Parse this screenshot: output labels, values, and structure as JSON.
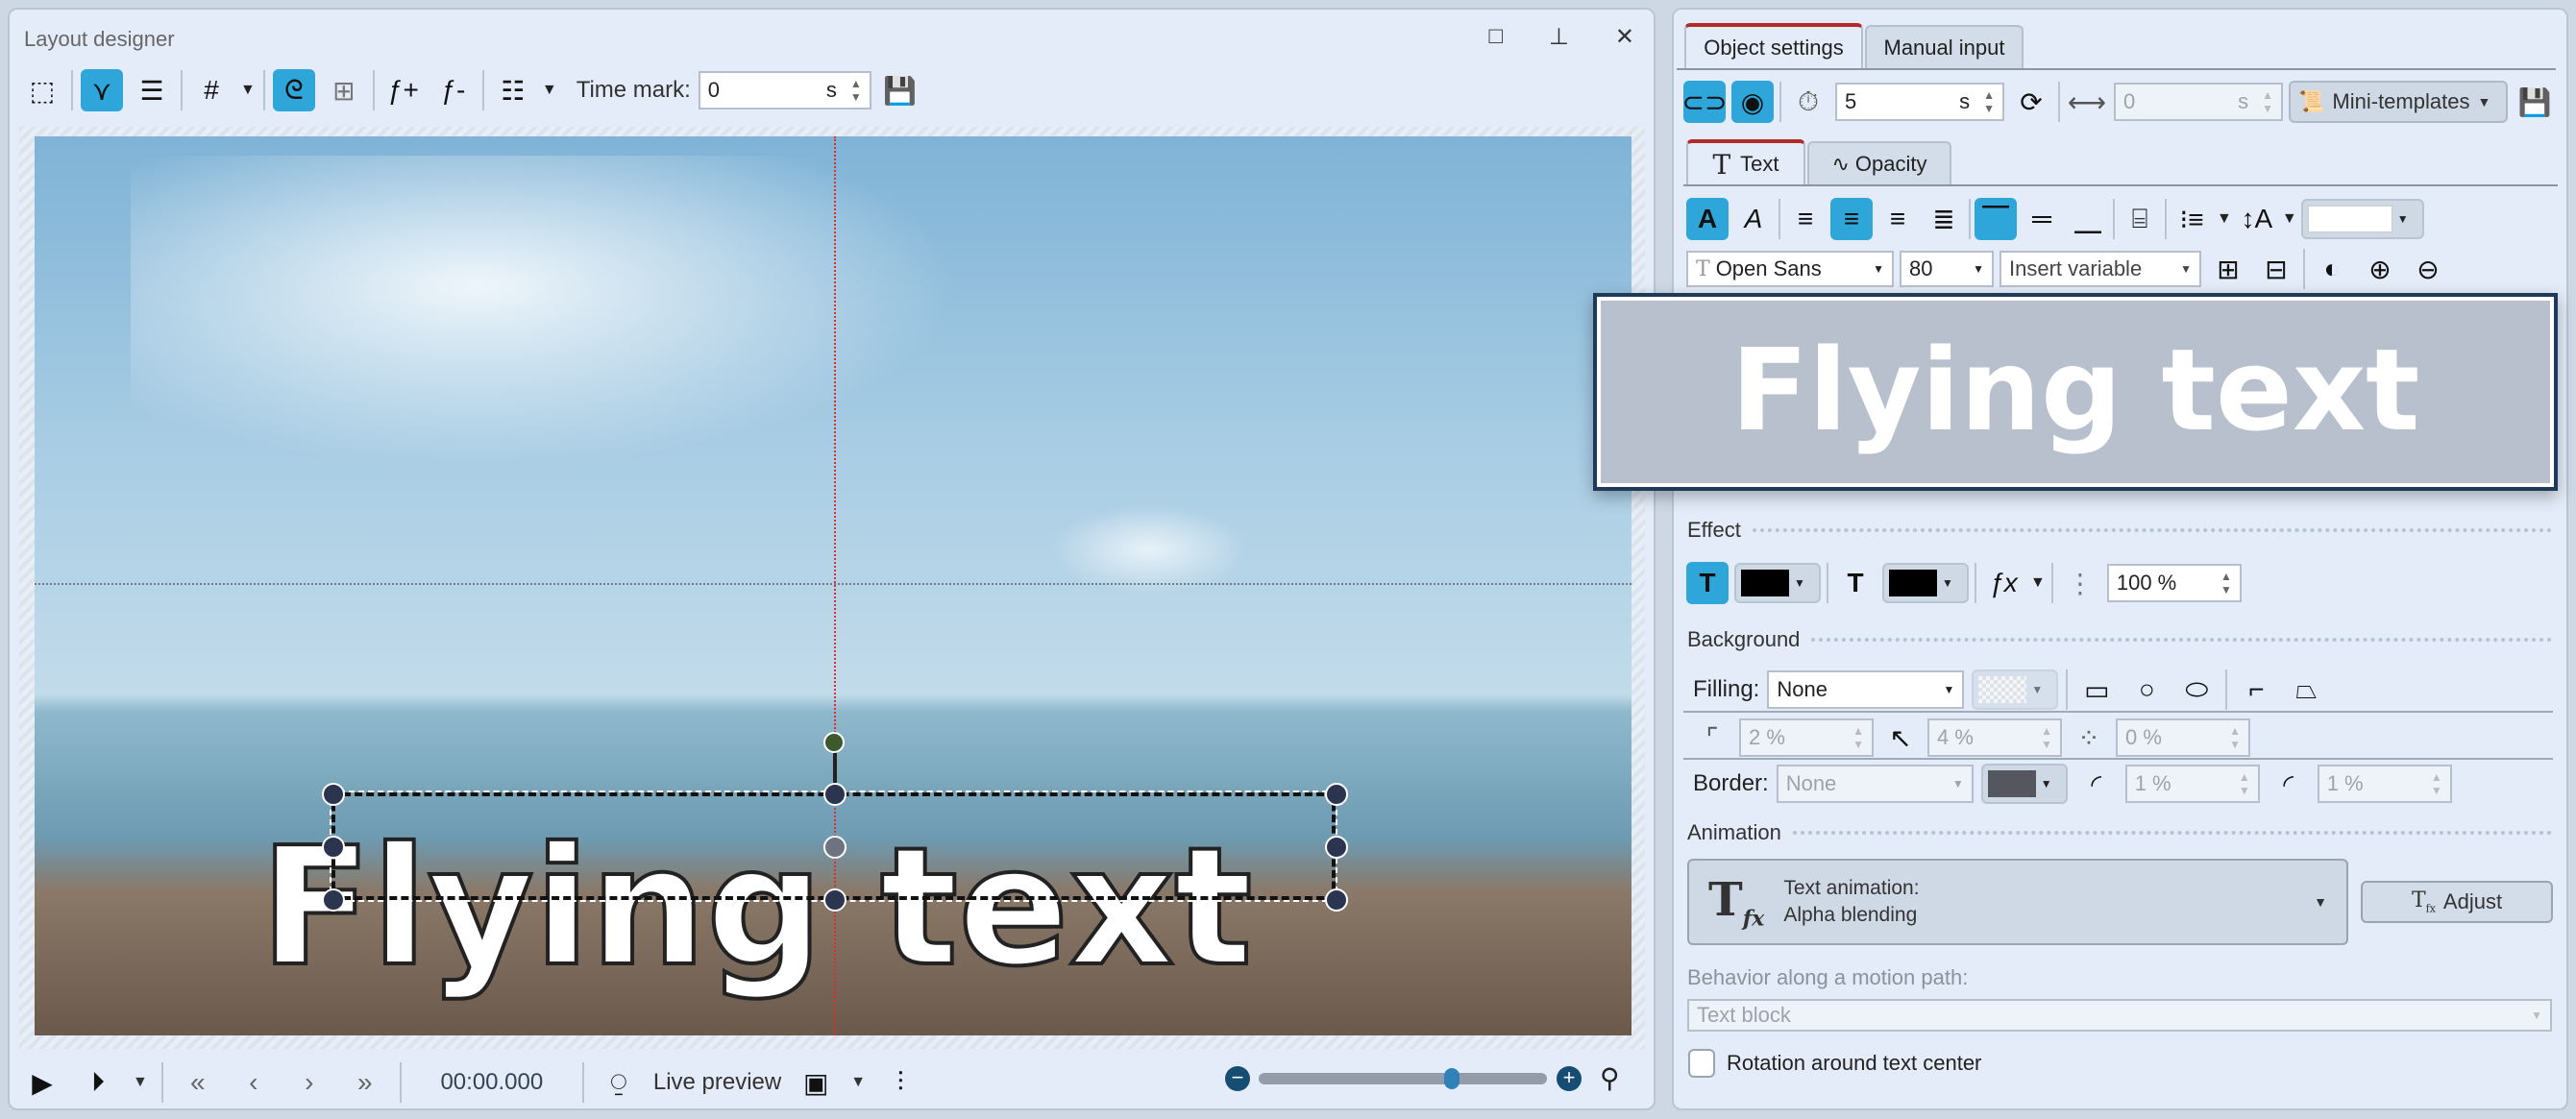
{
  "left_panel": {
    "title": "Layout designer",
    "time_mark_label": "Time mark:",
    "time_mark_value": "0",
    "time_mark_unit": "s",
    "timecode": "00:00.000",
    "live_preview": "Live preview",
    "zoom_slider_value": 0.67
  },
  "canvas": {
    "text": "Flying text"
  },
  "right_panel": {
    "tabs": [
      "Object settings",
      "Manual input"
    ],
    "duration_value": "5",
    "duration_unit": "s",
    "offset_value": "0",
    "offset_unit": "s",
    "mini_templates": "Mini-templates",
    "sub_tabs": [
      "Text",
      "Opacity"
    ],
    "font": "Open Sans",
    "font_size": "80",
    "insert_variable": "Insert variable",
    "preview_text": "Flying text",
    "effect": {
      "title": "Effect",
      "opacity": "100 %"
    },
    "background": {
      "title": "Background",
      "filling_label": "Filling:",
      "filling_value": "None",
      "padding": "2 %",
      "radius": "4 %",
      "softness": "0 %",
      "border_label": "Border:",
      "border_value": "None",
      "border_width": "1 %",
      "border_radius": "1 %"
    },
    "animation": {
      "title": "Animation",
      "type_label": "Text animation:",
      "type_value": "Alpha blending",
      "adjust": "Adjust",
      "behavior_label": "Behavior along a motion path:",
      "behavior_value": "Text block",
      "rotation_label": "Rotation around text center",
      "rotation_checked": false
    }
  },
  "colors": {
    "accent": "#2ea6da",
    "tab_marker": "#b22a2a",
    "preview_border": "#1e3a5a",
    "preview_bg": "#b7c0cc"
  }
}
